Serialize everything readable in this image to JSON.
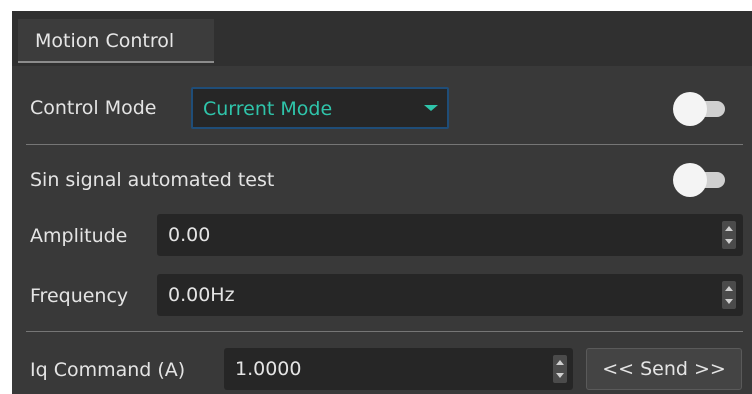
{
  "tab": {
    "label": "Motion Control"
  },
  "control_mode": {
    "label": "Control Mode",
    "selected": "Current Mode",
    "enabled": false
  },
  "sin_test": {
    "label": "Sin signal automated test",
    "enabled": false
  },
  "amplitude": {
    "label": "Amplitude",
    "value": "0.00"
  },
  "frequency": {
    "label": "Frequency",
    "value": "0.00Hz"
  },
  "iq_command": {
    "label": "Iq Command (A)",
    "value": "1.0000"
  },
  "send": {
    "label": "<< Send >>"
  },
  "colors": {
    "panel_bg": "#393939",
    "field_bg": "#262626",
    "accent_teal": "#2fc4aa",
    "select_border": "#1f4d78"
  }
}
